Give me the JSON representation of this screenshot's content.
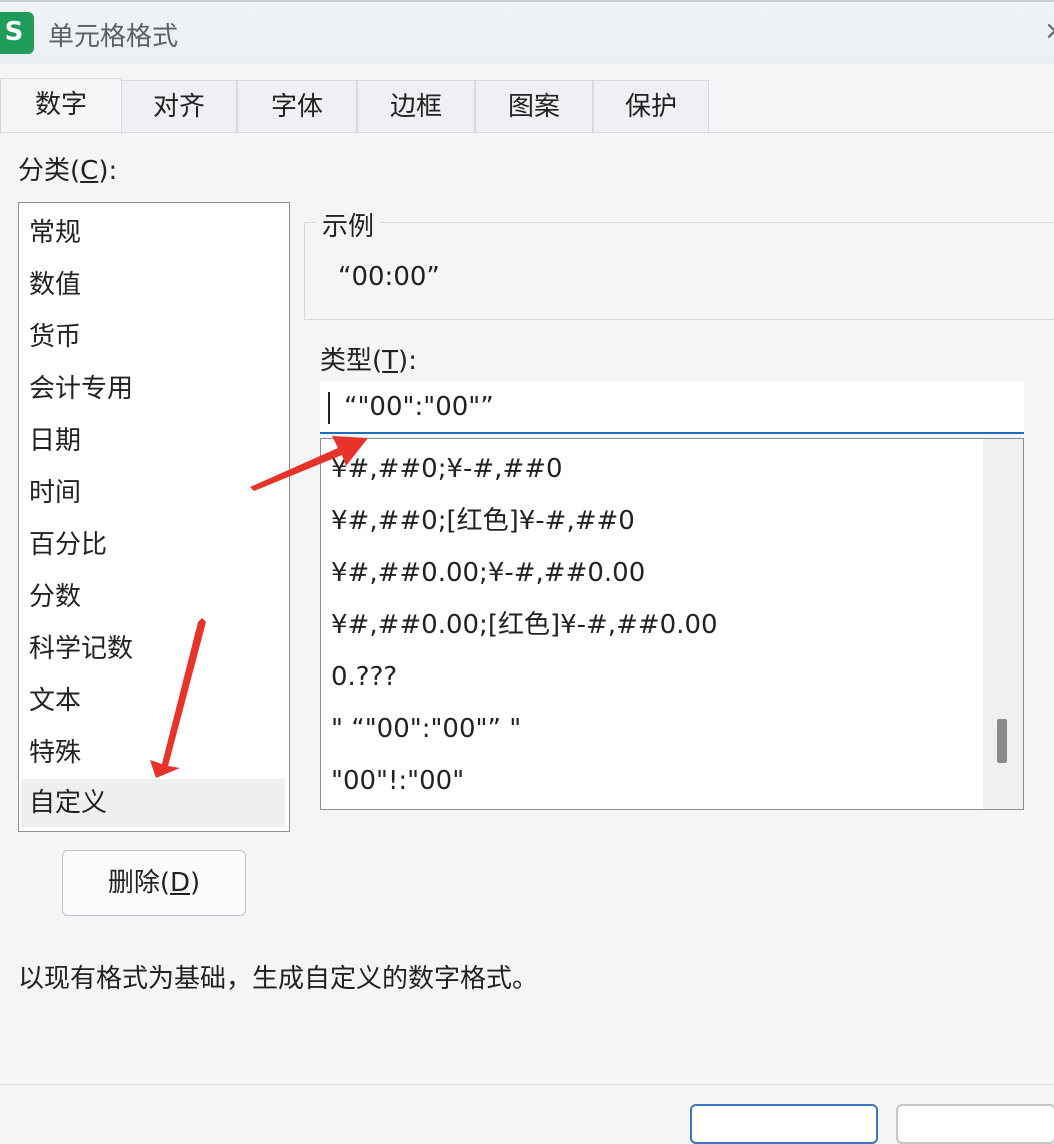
{
  "window": {
    "title": "单元格格式",
    "app_icon_letter": "S",
    "close_symbol": "×"
  },
  "tabs": [
    {
      "label": "数字",
      "active": true
    },
    {
      "label": "对齐"
    },
    {
      "label": "字体"
    },
    {
      "label": "边框"
    },
    {
      "label": "图案"
    },
    {
      "label": "保护"
    }
  ],
  "category": {
    "label_prefix": "分类(",
    "label_key": "C",
    "label_suffix": "):",
    "items": [
      "常规",
      "数值",
      "货币",
      "会计专用",
      "日期",
      "时间",
      "百分比",
      "分数",
      "科学记数",
      "文本",
      "特殊",
      "自定义"
    ],
    "selected": "自定义"
  },
  "sample": {
    "legend": "示例",
    "value": "“00:00”"
  },
  "type": {
    "label_prefix": "类型(",
    "label_key": "T",
    "label_suffix": "):",
    "value": "“\"00\":\"00\"”"
  },
  "formats": [
    "¥#,##0;¥-#,##0",
    "¥#,##0;[红色]¥-#,##0",
    "¥#,##0.00;¥-#,##0.00",
    "¥#,##0.00;[红色]¥-#,##0.00",
    "0.???",
    "\" “\"00\":\"00\"” \"",
    "\"00\"!:\"00\""
  ],
  "buttons": {
    "delete_prefix": "删除(",
    "delete_key": "D",
    "delete_suffix": ")"
  },
  "description": "以现有格式为基础，生成自定义的数字格式。",
  "colors": {
    "accent": "#1f6fbf",
    "arrow": "#e8332a",
    "app_icon": "#1f9c5a"
  },
  "icons": {
    "app": "spreadsheet-s-icon",
    "close": "close-icon",
    "annotation": "red-arrow-icon"
  }
}
